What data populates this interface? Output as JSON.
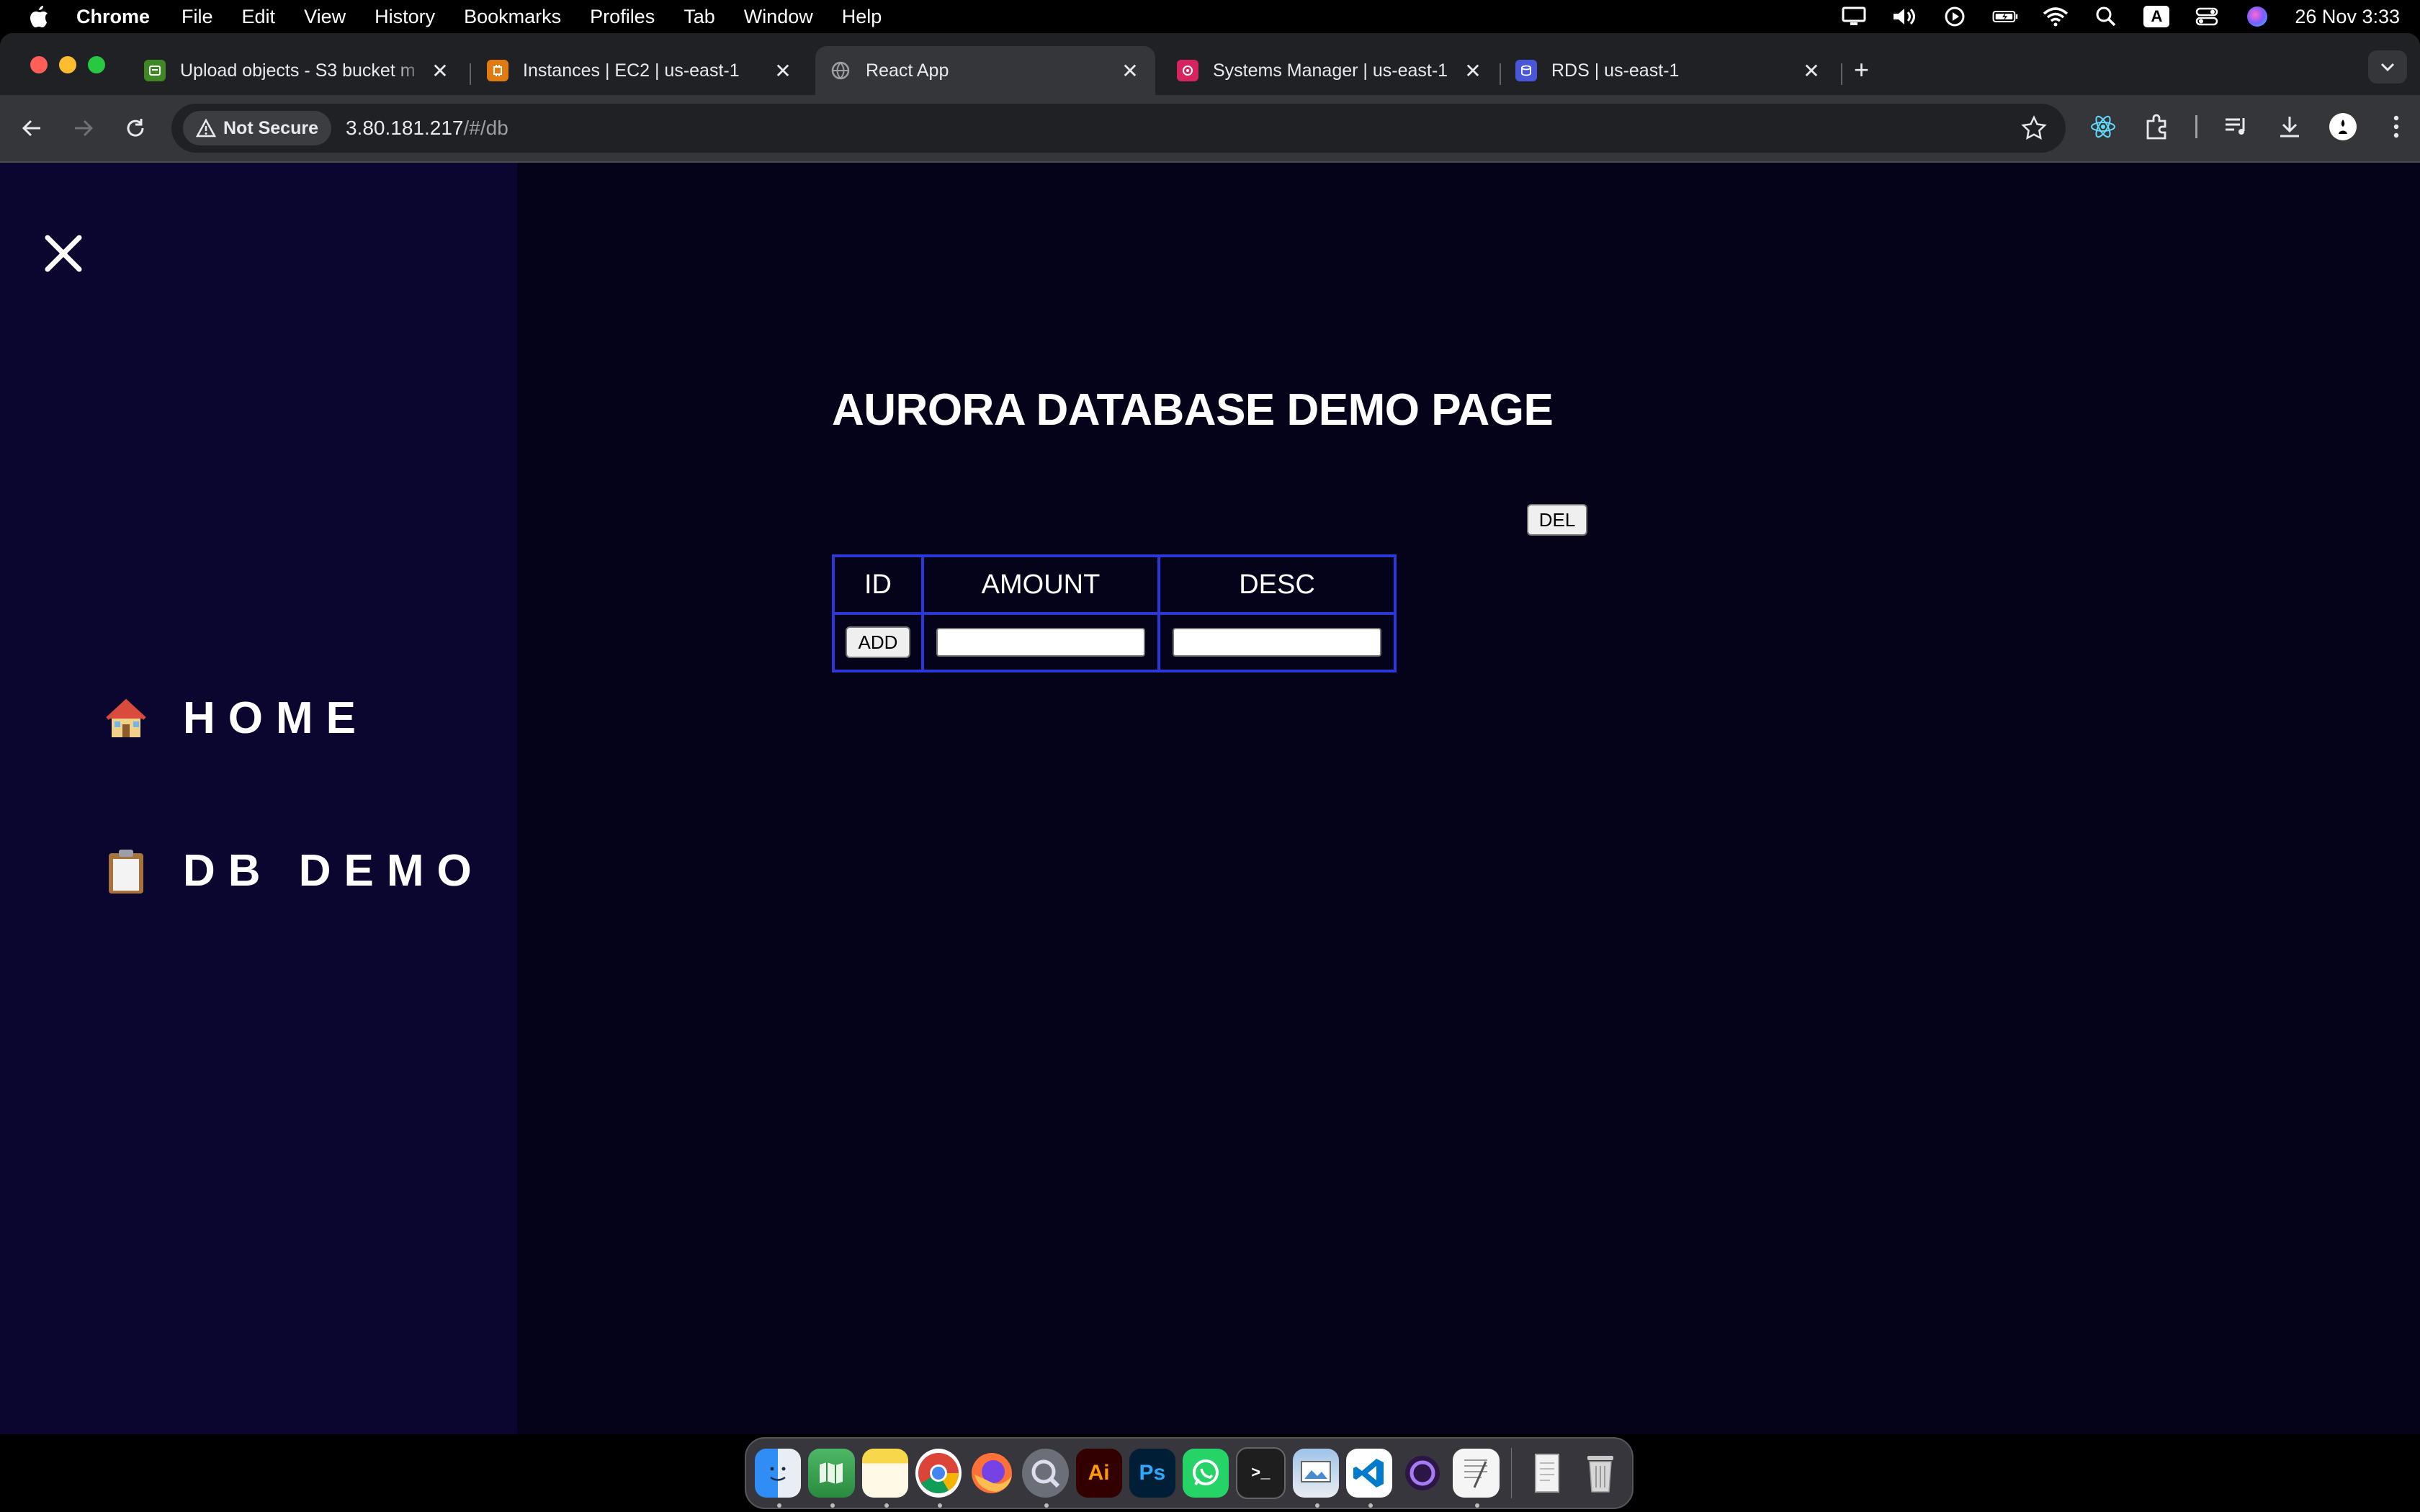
{
  "menubar": {
    "app_name": "Chrome",
    "items": [
      "File",
      "Edit",
      "View",
      "History",
      "Bookmarks",
      "Profiles",
      "Tab",
      "Window",
      "Help"
    ],
    "clock": "26 Nov  3:33",
    "status_icons": [
      "display-icon",
      "volume-icon",
      "play-icon",
      "battery-icon",
      "wifi-icon",
      "search-icon",
      "input-source-icon",
      "control-center-icon",
      "siri-icon"
    ],
    "input_source": "A"
  },
  "tabs": [
    {
      "title": "Upload objects - S3 bucket m",
      "favicon": "s3-icon",
      "color": "#3f8624",
      "active": false
    },
    {
      "title": "Instances | EC2 | us-east-1",
      "favicon": "ec2-icon",
      "color": "#e07b12",
      "active": false
    },
    {
      "title": "React App",
      "favicon": "globe-icon",
      "color": "#9aa0a6",
      "active": true
    },
    {
      "title": "Systems Manager | us-east-1",
      "favicon": "systems-manager-icon",
      "color": "#d6245f",
      "active": false
    },
    {
      "title": "RDS | us-east-1",
      "favicon": "rds-icon",
      "color": "#4a56d8",
      "active": false
    }
  ],
  "toolbar": {
    "security_label": "Not Secure",
    "url_host": "3.80.181.217",
    "url_path": "/#/db"
  },
  "sidebar": {
    "items": [
      {
        "emoji": "🏠",
        "label": "HOME"
      },
      {
        "emoji": "📋",
        "label": "DB DEMO"
      }
    ]
  },
  "main": {
    "title": "AURORA DATABASE DEMO PAGE",
    "del_label": "DEL",
    "table": {
      "headers": [
        "ID",
        "AMOUNT",
        "DESC"
      ],
      "add_label": "ADD",
      "amount_value": "",
      "desc_value": ""
    }
  },
  "dock": {
    "apps": [
      "Finder",
      "Maps",
      "Notes",
      "Chrome",
      "Firefox",
      "QuickTime Player",
      "Illustrator",
      "Photoshop",
      "WhatsApp",
      "Terminal",
      "Preview",
      "Visual Studio Code",
      "Tor Browser",
      "TextEdit",
      "Documents",
      "Trash"
    ],
    "illustrator_label": "Ai",
    "photoshop_label": "Ps",
    "terminal_label": ">_"
  },
  "colors": {
    "page_bg": "#05031a",
    "sidebar_bg": "#0b0630",
    "table_border": "#2b37d6"
  }
}
